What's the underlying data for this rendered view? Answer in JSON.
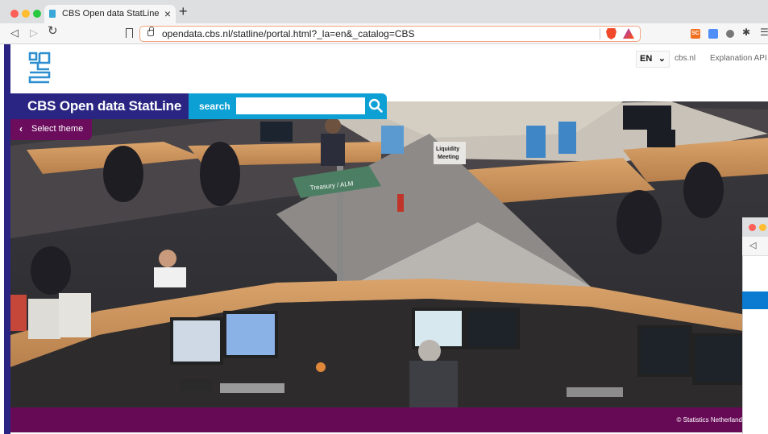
{
  "browser": {
    "tab_title": "CBS Open data StatLine",
    "tab_close": "×",
    "new_tab": "+",
    "url": "opendata.cbs.nl/statline/portal.html?_la=en&_catalog=CBS",
    "extension_sc_label": "SC"
  },
  "header": {
    "language": "EN",
    "links": [
      "cbs.nl",
      "Explanation API"
    ]
  },
  "brand": {
    "title": "CBS Open data StatLine",
    "search_label": "search",
    "search_value": ""
  },
  "theme_button": {
    "label": "Select theme"
  },
  "hero_image": {
    "sign_liquidity": "Liquidity\nMeeting",
    "sign_treasury": "Treasury / ALM"
  },
  "footer": {
    "text": "© Statistics Netherlands"
  },
  "colors": {
    "brand_navy": "#2a2582",
    "search_blue": "#0ca0d4",
    "theme_purple": "#6b0c5d",
    "footer_purple": "#660a56"
  },
  "icons": [
    "search-icon",
    "chevron-left-icon",
    "chevron-down-icon",
    "cbs-logo",
    "lock-icon",
    "bookmark-icon",
    "brave-shield-icon"
  ]
}
